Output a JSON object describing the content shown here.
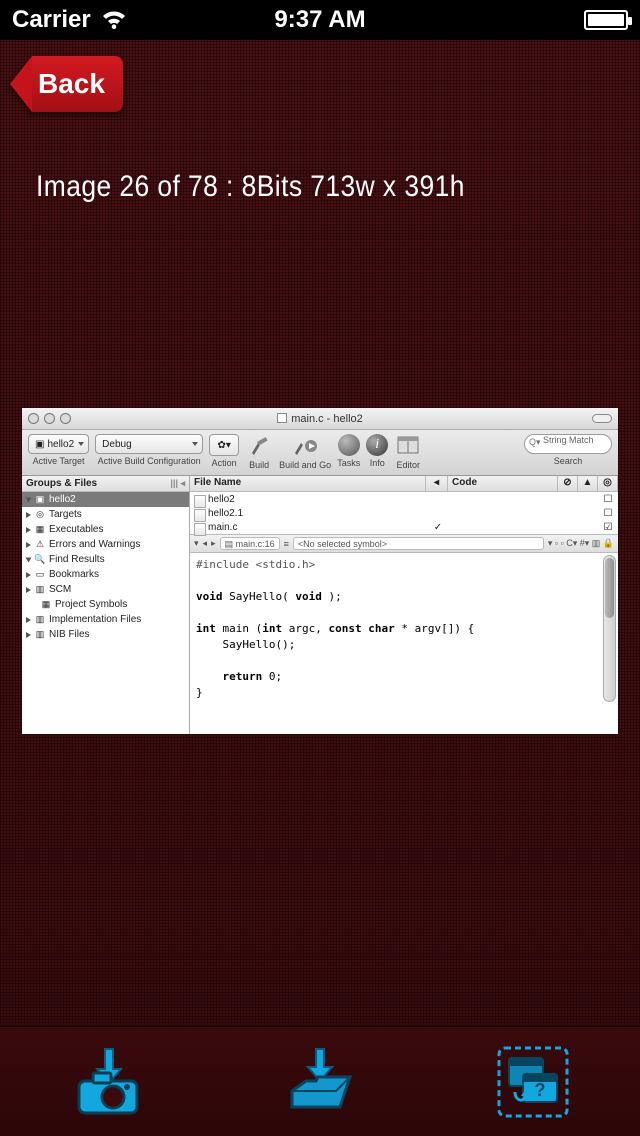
{
  "statusbar": {
    "carrier": "Carrier",
    "time": "9:37 AM"
  },
  "nav": {
    "back_label": "Back"
  },
  "caption": "Image 26 of 78 : 8Bits 713w x 391h",
  "xcode": {
    "window_title": "main.c - hello2",
    "active_target_label": "Active Target",
    "active_target_value": "hello2",
    "build_config_label": "Active Build Configuration",
    "build_config_value": "Debug",
    "action_label": "Action",
    "toolbar": {
      "build": "Build",
      "build_go": "Build and Go",
      "tasks": "Tasks",
      "info": "Info",
      "editor": "Editor",
      "search": "Search",
      "search_value": "String Match"
    },
    "sidebar": {
      "header": "Groups & Files",
      "items": [
        "hello2",
        "Targets",
        "Executables",
        "Errors and Warnings",
        "Find Results",
        "Bookmarks",
        "SCM",
        "Project Symbols",
        "Implementation Files",
        "NIB Files"
      ]
    },
    "columns": {
      "file": "File Name",
      "code": "Code"
    },
    "files": [
      {
        "name": "hello2",
        "checked": false
      },
      {
        "name": "hello2.1",
        "checked": false
      },
      {
        "name": "main.c",
        "checked": true
      }
    ],
    "navbar": {
      "file": "main.c:16",
      "symbol": "<No selected symbol>"
    },
    "code_lines": [
      "#include <stdio.h>",
      "",
      "void SayHello( void );",
      "",
      "int main (int argc, const char * argv[]) {",
      "    SayHello();",
      "",
      "    return 0;",
      "}"
    ]
  }
}
